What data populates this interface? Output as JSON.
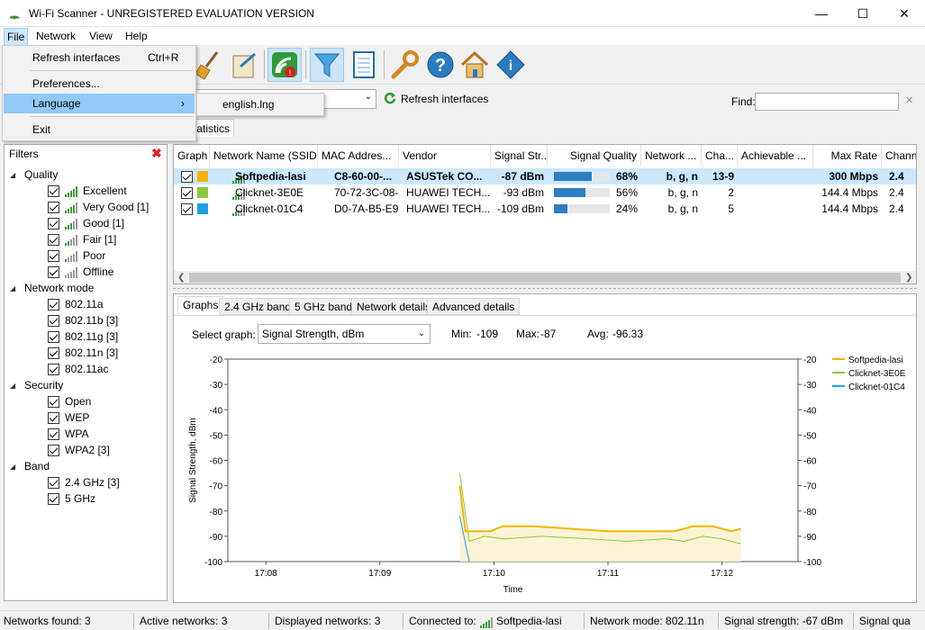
{
  "window": {
    "title": "Wi-Fi Scanner - UNREGISTERED EVALUATION VERSION",
    "minimize": "—",
    "maximize": "☐",
    "close": "✕"
  },
  "menubar": [
    "File",
    "Network",
    "View",
    "Help"
  ],
  "file_menu": {
    "refresh": "Refresh interfaces",
    "refresh_shortcut": "Ctrl+R",
    "preferences": "Preferences...",
    "language": "Language",
    "language_arrow": "›",
    "exit": "Exit"
  },
  "language_submenu": {
    "item": "english.lng"
  },
  "ifbar": {
    "refresh_label": "Refresh interfaces",
    "find_label": "Find:",
    "find_value": "",
    "partial_tab": "tatistics"
  },
  "filters": {
    "header": "Filters",
    "groups": [
      {
        "label": "Quality",
        "items": [
          "Excellent",
          "Very Good [1]",
          "Good [1]",
          "Fair [1]",
          "Poor",
          "Offline"
        ]
      },
      {
        "label": "Network mode",
        "items": [
          "802.11a",
          "802.11b [3]",
          "802.11g [3]",
          "802.11n [3]",
          "802.11ac"
        ]
      },
      {
        "label": "Security",
        "items": [
          "Open",
          "WEP",
          "WPA",
          "WPA2 [3]"
        ]
      },
      {
        "label": "Band",
        "items": [
          "2.4 GHz [3]",
          "5 GHz"
        ]
      }
    ]
  },
  "table": {
    "headers": [
      "Graph",
      "Network Name (SSID)",
      "MAC Addres...",
      "Vendor",
      "Signal Str...",
      "Signal Quality",
      "Network ...",
      "Cha...",
      "Achievable ...",
      "Max Rate",
      "Chann"
    ],
    "rows": [
      {
        "color": "#f5b300",
        "ssid": "Softpedia-lasi",
        "mac": "C8-60-00-...",
        "vendor": "ASUSTek CO...",
        "signal": "-87 dBm",
        "quality": "68%",
        "quality_value": 0.68,
        "mode": "b, g, n",
        "channel": "13-9",
        "achievable": "",
        "maxrate": "300 Mbps",
        "chan2": "2.4",
        "bold": true
      },
      {
        "color": "#8dc63f",
        "ssid": "Clicknet-3E0E",
        "mac": "70-72-3C-08-...",
        "vendor": "HUAWEI TECH...",
        "signal": "-93 dBm",
        "quality": "56%",
        "quality_value": 0.56,
        "mode": "b, g, n",
        "channel": "2",
        "achievable": "",
        "maxrate": "144.4 Mbps",
        "chan2": "2.4",
        "bold": false
      },
      {
        "color": "#1ea0e6",
        "ssid": "Clicknet-01C4",
        "mac": "D0-7A-B5-E9...",
        "vendor": "HUAWEI TECH...",
        "signal": "-109 dBm",
        "quality": "24%",
        "quality_value": 0.24,
        "mode": "b, g, n",
        "channel": "5",
        "achievable": "",
        "maxrate": "144.4 Mbps",
        "chan2": "2.4",
        "bold": false
      }
    ]
  },
  "tabs": [
    "Graphs",
    "2.4 GHz band",
    "5 GHz band",
    "Network details",
    "Advanced details"
  ],
  "graph_controls": {
    "select_label": "Select graph:",
    "select_value": "Signal Strength, dBm",
    "min_label": "Min:",
    "min_value": "-109",
    "max_label": "Max:",
    "max_value": "-87",
    "avg_label": "Avg:",
    "avg_value": "-96.33"
  },
  "chart_data": {
    "type": "line",
    "ylabel": "Signal Strength, dBm",
    "xlabel": "Time",
    "ylim": [
      -100,
      -20
    ],
    "yticks": [
      "-20",
      "-30",
      "-40",
      "-50",
      "-60",
      "-70",
      "-80",
      "-90",
      "-100"
    ],
    "xticks": [
      "17:08",
      "17:09",
      "17:10",
      "17:11",
      "17:12"
    ],
    "legend_position": "top-right",
    "series": [
      {
        "name": "Softpedia-lasi",
        "color": "#f5b300",
        "x": [
          "17:09:42",
          "17:09:45",
          "17:09:58",
          "17:10:05",
          "17:10:20",
          "17:10:40",
          "17:11:00",
          "17:11:20",
          "17:11:35",
          "17:11:45",
          "17:11:55",
          "17:12:05",
          "17:12:10"
        ],
        "values": [
          -70,
          -88,
          -88,
          -86,
          -86,
          -87,
          -88,
          -88,
          -88,
          -86,
          -86,
          -88,
          -87
        ]
      },
      {
        "name": "Clicknet-3E0E",
        "color": "#8dc63f",
        "x": [
          "17:09:42",
          "17:09:47",
          "17:09:55",
          "17:10:05",
          "17:10:25",
          "17:10:50",
          "17:11:10",
          "17:11:30",
          "17:11:40",
          "17:11:50",
          "17:12:00",
          "17:12:10"
        ],
        "values": [
          -65,
          -92,
          -90,
          -91,
          -90,
          -91,
          -92,
          -91,
          -92,
          -90,
          -91,
          -93
        ]
      },
      {
        "name": "Clicknet-01C4",
        "color": "#1ea0e6",
        "x": [
          "17:09:42",
          "17:09:47"
        ],
        "values": [
          -82,
          -100
        ]
      }
    ]
  },
  "statusbar": [
    "Networks found: 3",
    "Active networks: 3",
    "Displayed networks: 3",
    "Connected to:",
    "Softpedia-lasi",
    "Network mode: 802.11n",
    "Signal strength: -67 dBm",
    "Signal qua"
  ]
}
